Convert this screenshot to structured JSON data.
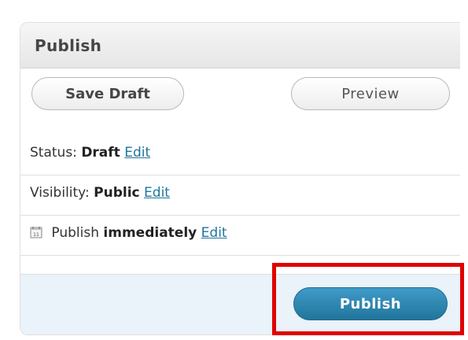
{
  "panel": {
    "title": "Publish"
  },
  "buttons": {
    "save_draft": "Save Draft",
    "preview": "Preview",
    "publish": "Publish"
  },
  "status": {
    "label": "Status:",
    "value": "Draft",
    "edit": "Edit"
  },
  "visibility": {
    "label": "Visibility:",
    "value": "Public",
    "edit": "Edit"
  },
  "schedule": {
    "icon": "calendar-icon",
    "label": "Publish",
    "value": "immediately",
    "edit": "Edit"
  },
  "colors": {
    "publish_button": "#21759b",
    "link": "#21759b",
    "highlight": "#e00000",
    "footer_bg": "#eaf2fa"
  }
}
